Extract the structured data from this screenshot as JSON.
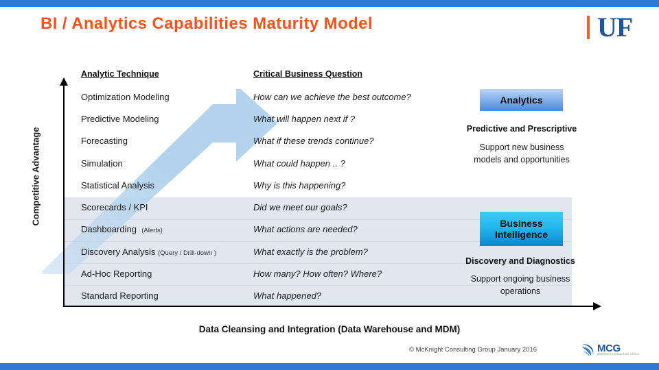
{
  "slide": {
    "title": "BI / Analytics Capabilities Maturity Model",
    "accent_color": "#2E7BD6",
    "title_color": "#F5521C"
  },
  "brand": {
    "uf_logo_text": "UF",
    "uf_bar_color": "#E8622A",
    "uf_text_color": "#1B5798"
  },
  "axes": {
    "y_label": "Competitive Advantage",
    "x_label": ""
  },
  "table": {
    "headers": {
      "technique": "Analytic Technique",
      "question": "Critical Business Question"
    },
    "rows": [
      {
        "technique": "Optimization Modeling",
        "note": "",
        "question": "How can we achieve the best outcome?"
      },
      {
        "technique": "Predictive Modeling",
        "note": "",
        "question": "What will happen next if ?"
      },
      {
        "technique": "Forecasting",
        "note": "",
        "question": "What if these trends continue?"
      },
      {
        "technique": "Simulation",
        "note": "",
        "question": "What could happen .. ?"
      },
      {
        "technique": "Statistical Analysis",
        "note": "",
        "question": "Why is this happening?"
      },
      {
        "technique": "Scorecards / KPI",
        "note": "",
        "question": "Did we meet our goals?"
      },
      {
        "technique": "Dashboarding",
        "note": "(Alerts)",
        "question": "What actions are needed?"
      },
      {
        "technique": "Discovery Analysis",
        "note": "(Query / Drill-down )",
        "question": "What exactly is the problem?"
      },
      {
        "technique": "Ad-Hoc Reporting",
        "note": "",
        "question": "How many? How often?  Where?"
      },
      {
        "technique": "Standard Reporting",
        "note": "",
        "question": "What happened?"
      }
    ]
  },
  "callouts": {
    "analytics": {
      "badge": "Analytics",
      "heading": "Predictive and Prescriptive",
      "body": "Support new business\nmodels and opportunities",
      "color_top": "#BBD3F2",
      "color_bottom": "#4A88DC"
    },
    "business_intelligence": {
      "badge": "Business\nIntelligence",
      "heading": "Discovery and Diagnostics",
      "body": "Support ongoing business\noperations",
      "color_top": "#3FCBF5",
      "color_bottom": "#0C86CF"
    }
  },
  "foundation": {
    "label": "Data Cleansing and Integration (Data Warehouse and MDM)"
  },
  "footer": {
    "copyright": "© McKnight Consulting Group January 2016",
    "logo_text": "MCG",
    "logo_subtext": "MCKNIGHT CONSULTING GROUP"
  }
}
